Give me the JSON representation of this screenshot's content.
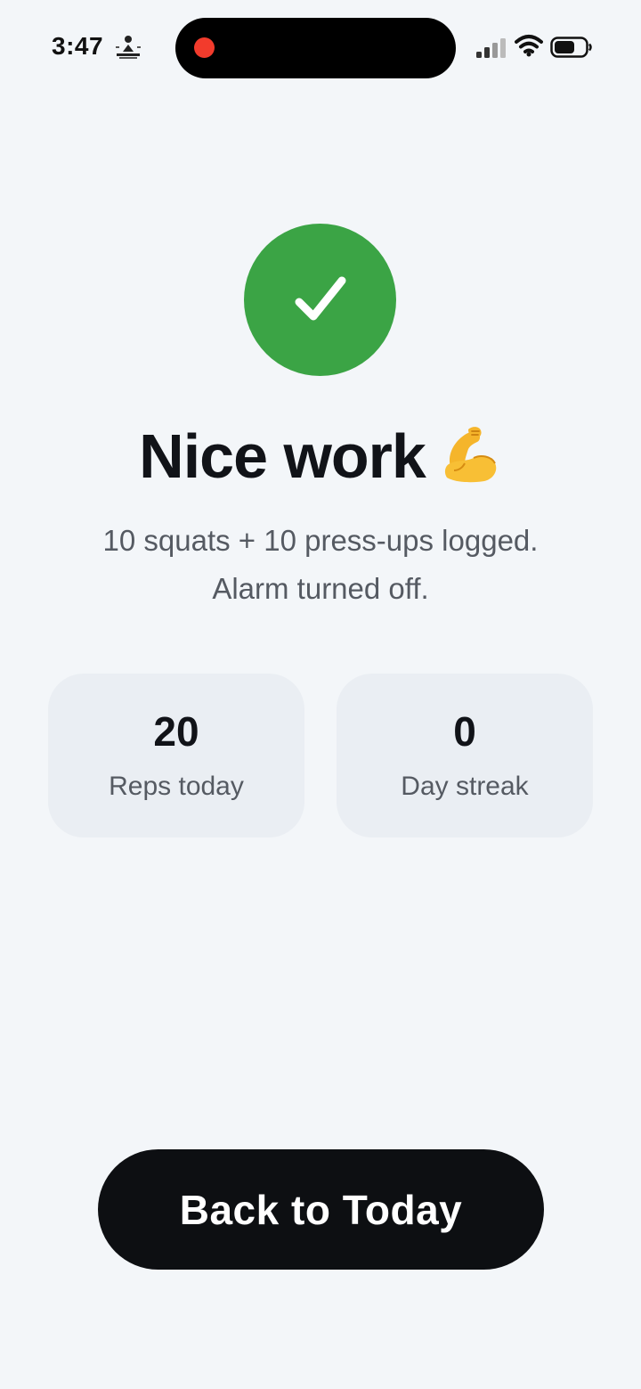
{
  "status_bar": {
    "time": "3:47",
    "icons": [
      "activity-icon",
      "recording-dot",
      "signal-icon",
      "wifi-icon",
      "battery-icon"
    ],
    "recording_color": "#f23b2c"
  },
  "success": {
    "icon": "checkmark-icon",
    "badge_color": "#3ba445"
  },
  "heading": {
    "text": "Nice work",
    "emoji_icon": "flexed-biceps-icon"
  },
  "message": {
    "line1": "10 squats + 10 press-ups logged.",
    "line2": "Alarm turned off."
  },
  "stats": [
    {
      "value": "20",
      "label": "Reps today"
    },
    {
      "value": "0",
      "label": "Day streak"
    }
  ],
  "actions": {
    "back_label": "Back to Today"
  },
  "colors": {
    "background": "#f3f6f9",
    "card": "#eaeef3",
    "primary_button": "#0d0f12",
    "text_primary": "#111318",
    "text_secondary": "#555a62"
  }
}
